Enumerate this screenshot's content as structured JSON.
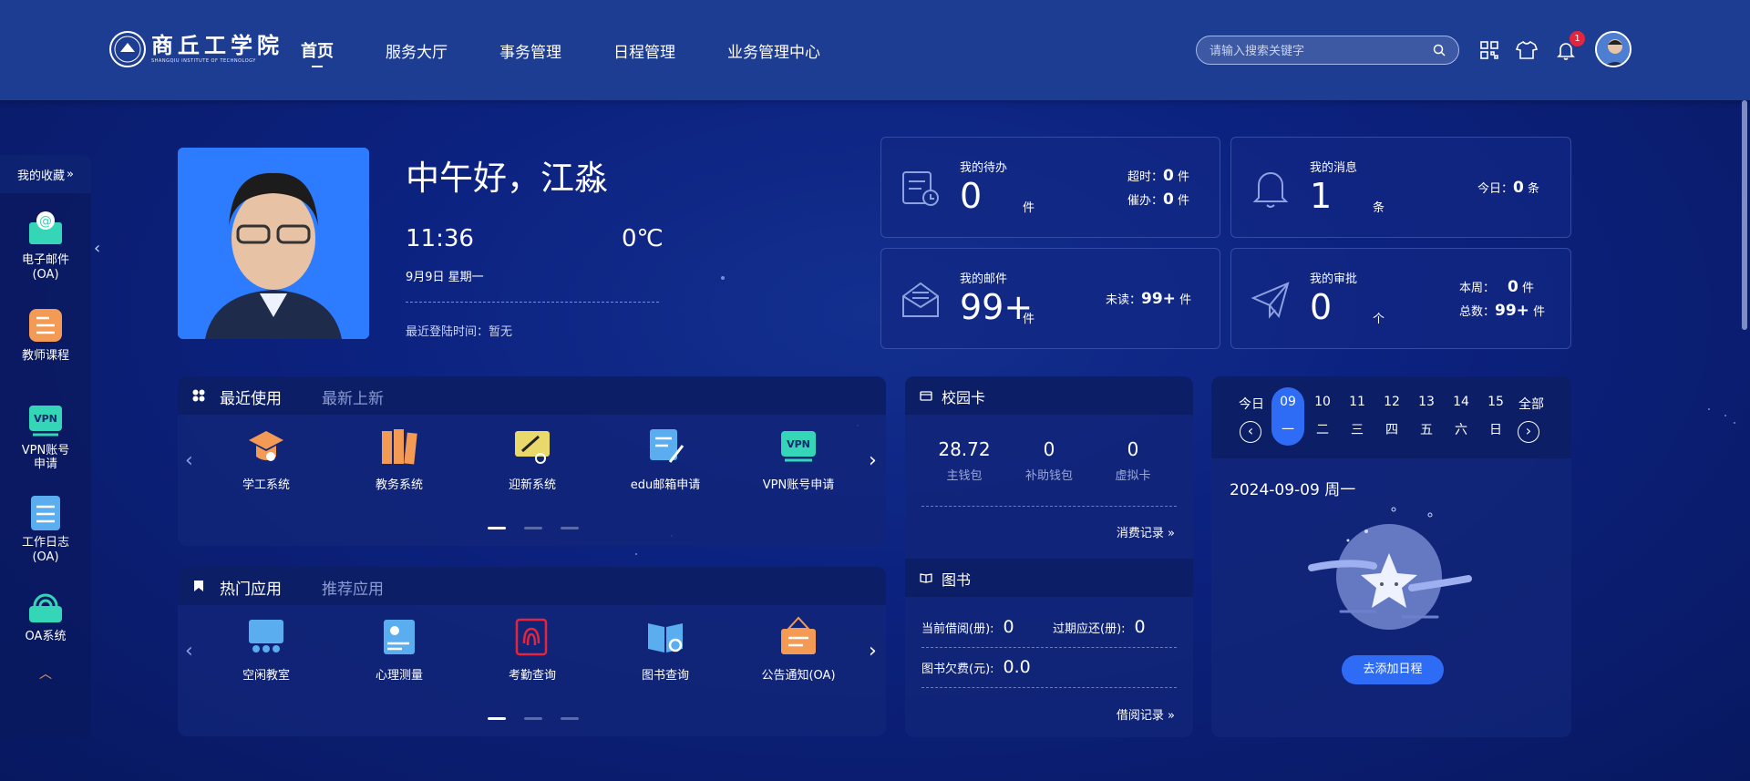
{
  "header": {
    "logo_cn": "商丘工学院",
    "logo_en": "SHANGQIU INSTITUTE OF TECHNOLOGY",
    "nav": [
      {
        "label": "首页",
        "active": true
      },
      {
        "label": "服务大厅"
      },
      {
        "label": "事务管理"
      },
      {
        "label": "日程管理"
      },
      {
        "label": "业务管理中心"
      }
    ],
    "search_placeholder": "请输入搜索关键字",
    "notification_count": "1",
    "icons": [
      "qrcode-icon",
      "shirt-icon",
      "bell-icon"
    ]
  },
  "sidebar": {
    "title": "我的收藏",
    "items": [
      {
        "label": "电子邮件(OA)",
        "icon": "email-icon",
        "color": "#34d6b7"
      },
      {
        "label": "教师课程",
        "icon": "course-icon",
        "color": "#f39a54"
      },
      {
        "label": "VPN账号申请",
        "icon": "vpn-icon",
        "color": "#34d6b7"
      },
      {
        "label": "工作日志(OA)",
        "icon": "log-icon",
        "color": "#5aaef0"
      },
      {
        "label": "OA系统",
        "icon": "oa-icon",
        "color": "#34d6b7"
      }
    ]
  },
  "profile": {
    "greeting": "中午好，江淼",
    "time": "11:36",
    "temperature": "0℃",
    "date": "9月9日 星期一",
    "last_login_label": "最近登陆时间：暂无"
  },
  "stats": {
    "todo": {
      "title": "我的待办",
      "value": "0",
      "unit": "件",
      "overdue_label": "超时：",
      "overdue": "0",
      "overdue_unit": "件",
      "urge_label": "催办：",
      "urge": "0",
      "urge_unit": "件"
    },
    "message": {
      "title": "我的消息",
      "value": "1",
      "unit": "条",
      "today_label": "今日：",
      "today": "0",
      "today_unit": "条"
    },
    "mail": {
      "title": "我的邮件",
      "value": "99+",
      "unit": "件",
      "unread_label": "未读：",
      "unread": "99+",
      "unread_unit": "件"
    },
    "approval": {
      "title": "我的审批",
      "value": "0",
      "unit": "个",
      "week_label": "本周：",
      "week": "0",
      "week_unit": "件",
      "total_label": "总数：",
      "total": "99+",
      "total_unit": "件"
    }
  },
  "recent": {
    "tab_active": "最近使用",
    "tab_inactive": "最新上新",
    "apps": [
      {
        "label": "学工系统",
        "icon": "graduation-icon",
        "color": "#f39a54"
      },
      {
        "label": "教务系统",
        "icon": "books-icon",
        "color": "#f39a54"
      },
      {
        "label": "迎新系统",
        "icon": "welcome-icon",
        "color": "#e8d96a"
      },
      {
        "label": "edu邮箱申请",
        "icon": "mail-apply-icon",
        "color": "#5aaef0"
      },
      {
        "label": "VPN账号申请",
        "icon": "vpn-icon",
        "color": "#34d6b7"
      }
    ]
  },
  "hot": {
    "tab_active": "热门应用",
    "tab_inactive": "推荐应用",
    "apps": [
      {
        "label": "空闲教室",
        "icon": "classroom-icon",
        "color": "#5aaef0"
      },
      {
        "label": "心理测量",
        "icon": "psych-icon",
        "color": "#5aaef0"
      },
      {
        "label": "考勤查询",
        "icon": "fingerprint-icon",
        "color": "#e8243c"
      },
      {
        "label": "图书查询",
        "icon": "book-search-icon",
        "color": "#5aaef0"
      },
      {
        "label": "公告通知(OA)",
        "icon": "notice-icon",
        "color": "#f39a54"
      }
    ]
  },
  "campus_card": {
    "title": "校园卡",
    "main_value": "28.72",
    "main_label": "主钱包",
    "sub_value": "0",
    "sub_label": "补助钱包",
    "virtual_value": "0",
    "virtual_label": "虚拟卡",
    "link": "消费记录"
  },
  "library": {
    "title": "图书",
    "borrow_label": "当前借阅(册):",
    "borrow_value": "0",
    "overdue_label": "过期应还(册):",
    "overdue_value": "0",
    "fee_label": "图书欠费(元):",
    "fee_value": "0.0",
    "link": "借阅记录"
  },
  "calendar": {
    "today_label": "今日",
    "all_label": "全部",
    "days": [
      {
        "num": "09",
        "week": "一",
        "selected": true
      },
      {
        "num": "10",
        "week": "二"
      },
      {
        "num": "11",
        "week": "三"
      },
      {
        "num": "12",
        "week": "四"
      },
      {
        "num": "13",
        "week": "五"
      },
      {
        "num": "14",
        "week": "六"
      },
      {
        "num": "15",
        "week": "日"
      }
    ],
    "date_text": "2024-09-09 周一",
    "add_button": "去添加日程"
  }
}
